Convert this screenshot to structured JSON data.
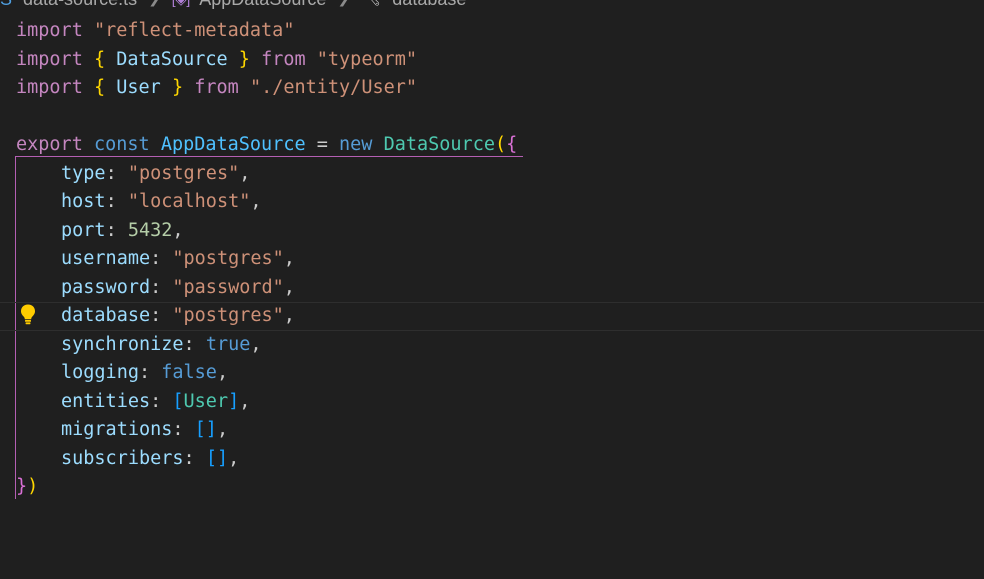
{
  "breadcrumb": {
    "file": "data-source.ts",
    "symbol": "AppDataSource",
    "property": "database",
    "file_icon": "typescript-file-icon",
    "symbol_icon": "variable-symbol-icon",
    "property_icon": "wrench-icon"
  },
  "code": {
    "l1_kw": "import",
    "l1_str": "\"reflect-metadata\"",
    "l2_kw": "import",
    "l2_open": "{",
    "l2_name": "DataSource",
    "l2_close": "}",
    "l2_from": "from",
    "l2_str": "\"typeorm\"",
    "l3_kw": "import",
    "l3_open": "{",
    "l3_name": "User",
    "l3_close": "}",
    "l3_from": "from",
    "l3_str": "\"./entity/User\"",
    "l5_export": "export",
    "l5_const": "const",
    "l5_var": "AppDataSource",
    "l5_eq": "=",
    "l5_new": "new",
    "l5_class": "DataSource",
    "l5_paren": "(",
    "l5_brace": "{",
    "type_key": "type",
    "type_val": "\"postgres\"",
    "host_key": "host",
    "host_val": "\"localhost\"",
    "port_key": "port",
    "port_val": "5432",
    "username_key": "username",
    "username_val": "\"postgres\"",
    "password_key": "password",
    "password_val": "\"password\"",
    "database_key": "database",
    "database_val": "\"postgres\"",
    "synchronize_key": "synchronize",
    "synchronize_val": "true",
    "logging_key": "logging",
    "logging_val": "false",
    "entities_key": "entities",
    "entities_open": "[",
    "entities_item": "User",
    "entities_close": "]",
    "migrations_key": "migrations",
    "migrations_val": "[]",
    "subscribers_key": "subscribers",
    "subscribers_val": "[]",
    "end_brace": "}",
    "end_paren": ")",
    "colon": ":",
    "comma": ","
  },
  "lightbulb_icon": "lightbulb-icon",
  "colors": {
    "background": "#1f1f1f",
    "keyword_control": "#c586c0",
    "keyword": "#569cd6",
    "string": "#ce9178",
    "number": "#b5cea8",
    "property": "#9cdcfe",
    "class": "#4ec9b0",
    "bracket_gold": "#ffd700",
    "bracket_pink": "#da70d6",
    "bracket_blue": "#179fff"
  }
}
